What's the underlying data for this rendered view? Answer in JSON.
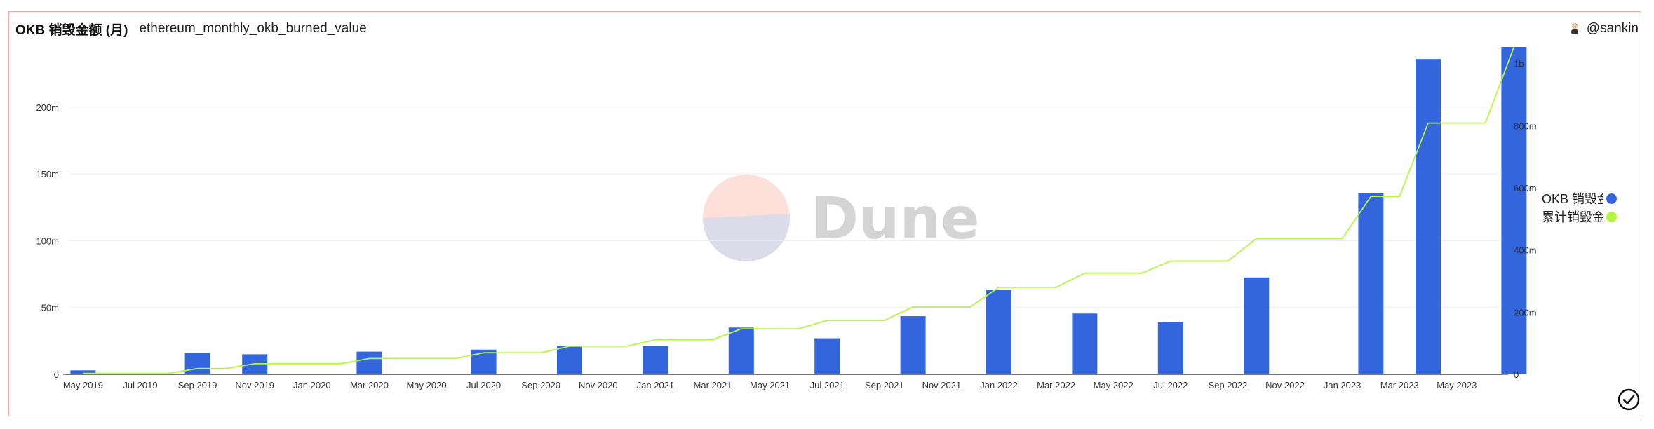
{
  "header": {
    "title": "OKB 销毁金额 (月)",
    "subtitle": "ethereum_monthly_okb_burned_value",
    "author": "@sankin"
  },
  "watermark": {
    "text": "Dune"
  },
  "icons": {
    "avatar": "avatar-icon",
    "check": "check-circle-icon"
  },
  "colors": {
    "bar": "#3366dd",
    "line": "#b5f545",
    "frame": "#f2a5a5",
    "grid": "#ededed"
  },
  "chart_data": {
    "type": "bar",
    "title": "OKB 销毁金额 (月)",
    "x": [
      "2019-05",
      "2019-06",
      "2019-07",
      "2019-08",
      "2019-09",
      "2019-10",
      "2019-11",
      "2019-12",
      "2020-01",
      "2020-02",
      "2020-03",
      "2020-04",
      "2020-05",
      "2020-06",
      "2020-07",
      "2020-08",
      "2020-09",
      "2020-10",
      "2020-11",
      "2020-12",
      "2021-01",
      "2021-02",
      "2021-03",
      "2021-04",
      "2021-05",
      "2021-06",
      "2021-07",
      "2021-08",
      "2021-09",
      "2021-10",
      "2021-11",
      "2021-12",
      "2022-01",
      "2022-02",
      "2022-03",
      "2022-04",
      "2022-05",
      "2022-06",
      "2022-07",
      "2022-08",
      "2022-09",
      "2022-10",
      "2022-11",
      "2022-12",
      "2023-01",
      "2023-02",
      "2023-03",
      "2023-04",
      "2023-05",
      "2023-06"
    ],
    "x_tick_labels": [
      "May 2019",
      "Jul 2019",
      "Sep 2019",
      "Nov 2019",
      "Jan 2020",
      "Mar 2020",
      "May 2020",
      "Jul 2020",
      "Sep 2020",
      "Nov 2020",
      "Jan 2021",
      "Mar 2021",
      "May 2021",
      "Jul 2021",
      "Sep 2021",
      "Nov 2021",
      "Jan 2022",
      "Mar 2022",
      "May 2022",
      "Jul 2022",
      "Sep 2022",
      "Nov 2022",
      "Jan 2023",
      "Mar 2023",
      "May 2023"
    ],
    "series": [
      {
        "name": "OKB 销毁金额",
        "type": "bar",
        "axis": "left",
        "color": "#3366dd",
        "values": [
          3,
          0,
          0,
          0,
          16,
          0,
          15,
          0,
          0,
          0,
          17,
          0,
          0,
          0,
          18.5,
          0,
          0,
          21,
          0,
          0,
          21,
          0,
          0,
          35,
          0,
          0,
          27,
          0,
          0,
          43.5,
          0,
          0,
          63,
          0,
          0,
          45.5,
          0,
          0,
          39,
          0,
          0,
          72.5,
          0,
          0,
          0,
          135.5,
          0,
          236,
          0,
          0,
          245
        ]
      },
      {
        "name": "累计销毁金额",
        "type": "line",
        "axis": "right",
        "color": "#b5f545",
        "values": [
          3,
          3,
          3,
          3,
          19,
          19,
          34,
          34,
          34,
          34,
          51,
          51,
          51,
          51,
          69.5,
          69.5,
          69.5,
          90.5,
          90.5,
          90.5,
          111.5,
          111.5,
          111.5,
          146.5,
          146.5,
          146.5,
          173.5,
          173.5,
          173.5,
          217,
          217,
          217,
          280,
          280,
          280,
          325.5,
          325.5,
          325.5,
          364.5,
          364.5,
          364.5,
          437,
          437,
          437,
          437,
          572.5,
          572.5,
          808.5,
          808.5,
          808.5,
          1053.5
        ]
      }
    ],
    "y_left": {
      "ticks": [
        0,
        50,
        100,
        150,
        200
      ],
      "tick_labels": [
        "0",
        "50m",
        "100m",
        "150m",
        "200m"
      ],
      "ylim": [
        0,
        245
      ]
    },
    "y_right": {
      "ticks": [
        0,
        200,
        400,
        600,
        800,
        1000
      ],
      "tick_labels": [
        "0",
        "200m",
        "400m",
        "600m",
        "800m",
        "1b"
      ],
      "ylim": [
        0,
        1053.5
      ]
    },
    "grid": true,
    "legend": {
      "placement": "right",
      "entries": [
        {
          "label": "OKB 销毁金",
          "color": "#3366dd"
        },
        {
          "label": "累计销毁金",
          "color": "#b5f545"
        }
      ]
    }
  }
}
